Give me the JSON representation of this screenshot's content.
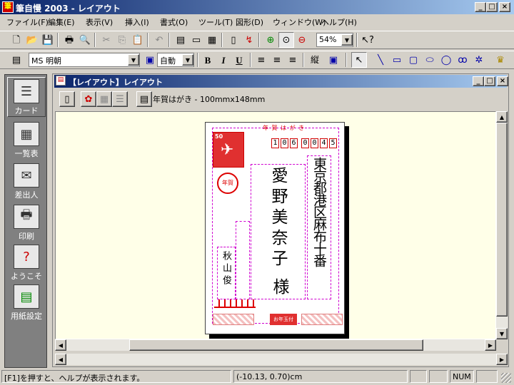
{
  "app": {
    "title": "筆自慢 2003 - レイアウト",
    "window_controls": {
      "minimize": "_",
      "maximize": "□",
      "close": "×"
    }
  },
  "menu": [
    "ファイル(F)",
    "編集(E)",
    "表示(V)",
    "挿入(I)",
    "書式(O)",
    "ツール(T)",
    "図形(D)",
    "ウィンドウ(W)",
    "ヘルプ(H)"
  ],
  "toolbar1": {
    "zoom": "54%"
  },
  "toolbar2": {
    "font_name": "MS 明朝",
    "font_size": "自動",
    "bold": "B",
    "italic": "I",
    "underline": "U",
    "vertical_label": "縦"
  },
  "sidebar": [
    {
      "label": "カード",
      "icon": "card-icon"
    },
    {
      "label": "一覧表",
      "icon": "list-icon"
    },
    {
      "label": "差出人",
      "icon": "sender-icon"
    },
    {
      "label": "印刷",
      "icon": "printer-icon"
    },
    {
      "label": "ようこそ",
      "icon": "welcome-icon"
    },
    {
      "label": "用紙設定",
      "icon": "paper-setup-icon"
    }
  ],
  "child_window": {
    "title": "【レイアウト】レイアウト",
    "paper": "年賀はがき - 100mmx148mm"
  },
  "postcard": {
    "header": "年 賀 は が き",
    "zip": [
      "1",
      "0",
      "6",
      "0",
      "0",
      "4",
      "5"
    ],
    "address": "東京都港区麻布十番",
    "recipient": "愛野美奈子",
    "honorific": "様",
    "sender": "秋山俊",
    "stamp_value": "50",
    "bottom_center": "お年玉付"
  },
  "statusbar": {
    "help": "[F1]を押すと、ヘルプが表示されます。",
    "coords": "(-10.13, 0.70)cm",
    "num": "NUM"
  },
  "colors": {
    "title_start": "#0a246a",
    "title_end": "#a6caf0",
    "canvas": "#ffffe8",
    "guide": "#d000d0",
    "stamp_red": "#e03030"
  }
}
